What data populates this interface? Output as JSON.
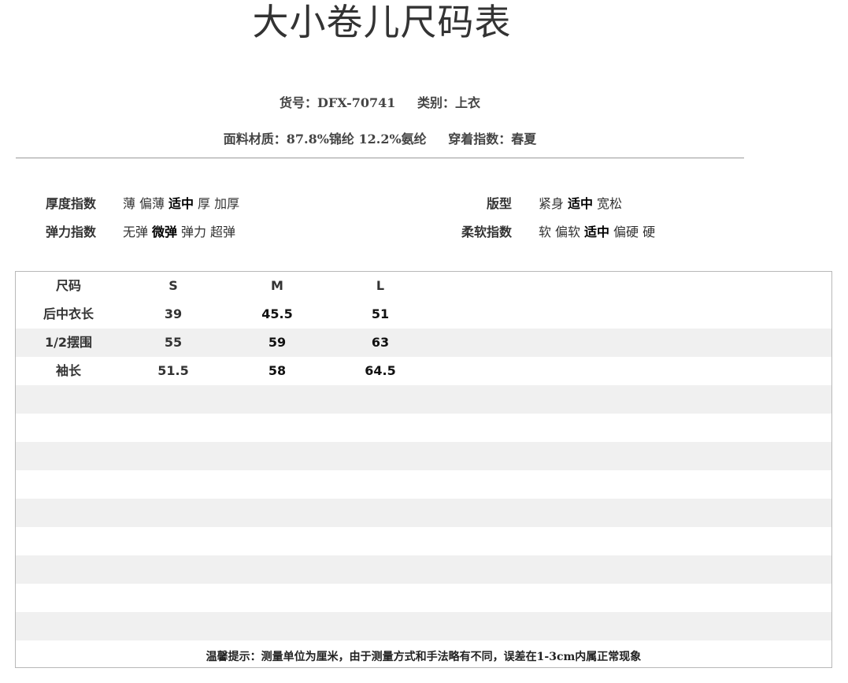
{
  "title": "大小卷儿尺码表",
  "meta": {
    "item_no": "货号：DFX-70741",
    "category": "类别：上衣",
    "fabric": "面料材质：87.8%锦纶 12.2%氨纶",
    "season": "穿着指数：春夏"
  },
  "attributes": {
    "thickness": {
      "label": "厚度指数",
      "options": [
        "薄",
        "偏薄",
        "适中",
        "厚",
        "加厚"
      ],
      "selected": "适中"
    },
    "elasticity": {
      "label": "弹力指数",
      "options": [
        "无弹",
        "微弹",
        "弹力",
        "超弹"
      ],
      "selected": "微弹"
    },
    "fit": {
      "label": "版型",
      "options": [
        "紧身",
        "适中",
        "宽松"
      ],
      "selected": "适中"
    },
    "softness": {
      "label": "柔软指数",
      "options": [
        "软",
        "偏软",
        "适中",
        "偏硬",
        "硬"
      ],
      "selected": "适中"
    }
  },
  "size_table": {
    "headers": [
      "尺码",
      "S",
      "M",
      "L"
    ],
    "rows": [
      [
        "后中衣长",
        "39",
        "45.5",
        "51"
      ],
      [
        "1/2摆围",
        "55",
        "59",
        "63"
      ],
      [
        "袖长",
        "51.5",
        "58",
        "64.5"
      ]
    ],
    "note": "温馨提示：测量单位为厘米，由于测量方式和手法略有不同，误差在1-3cm内属正常现象"
  }
}
